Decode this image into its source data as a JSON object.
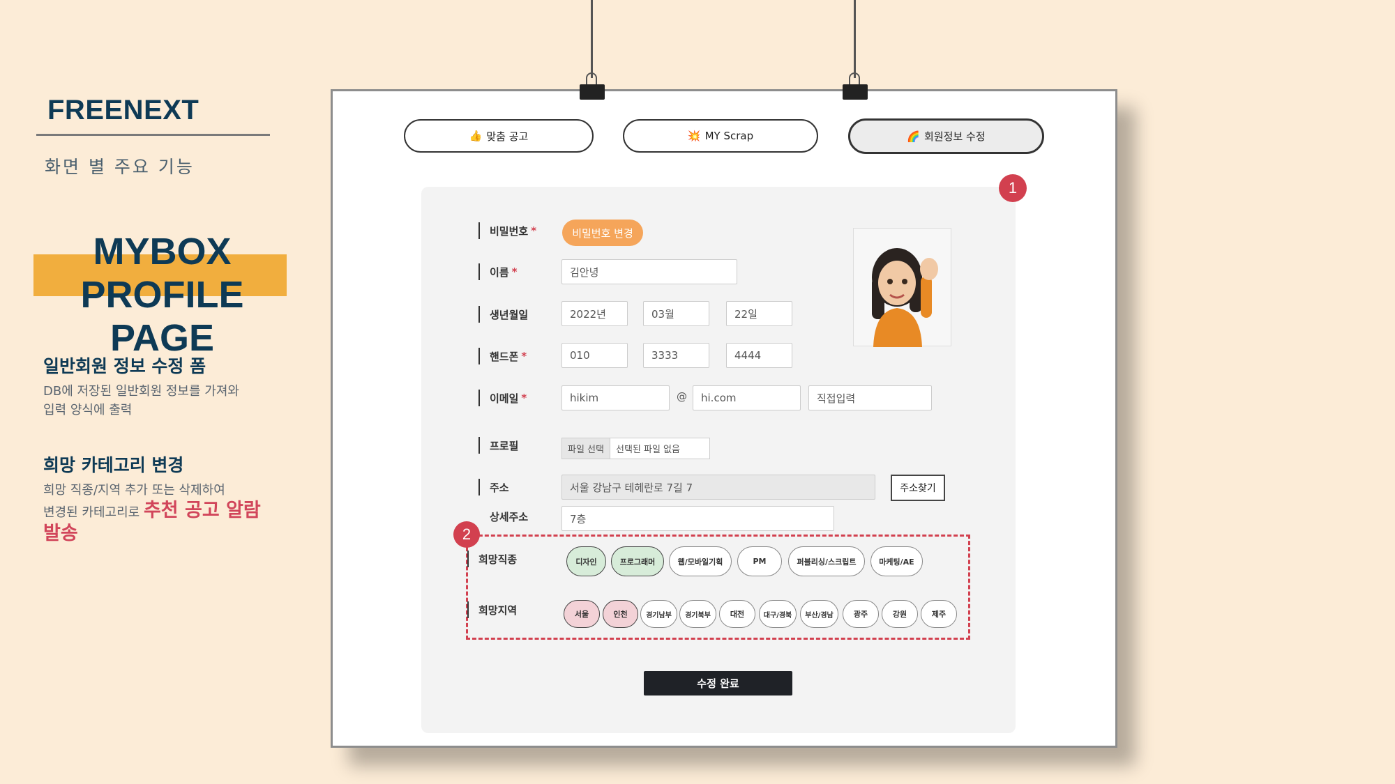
{
  "left": {
    "brand": "FREENEXT",
    "subtitle": "화면 별 주요 기능",
    "title_line1": "MYBOX",
    "title_line2": "PROFILE PAGE",
    "section1": {
      "heading": "일반회원 정보 수정 폼",
      "line1": "DB에 저장된 일반회원 정보를 가져와",
      "line2": "입력 양식에 출력"
    },
    "section2": {
      "heading": "희망 카테고리 변경",
      "line1": "희망 직종/지역 추가 또는 삭제하여",
      "line2_plain": "변경된 카테고리로 ",
      "line2_accent": "추천 공고 알람",
      "line3_accent": "발송"
    }
  },
  "tabs": [
    {
      "icon": "👍",
      "label": "맞춤 공고",
      "active": false
    },
    {
      "icon": "💥",
      "label": "MY Scrap",
      "active": false
    },
    {
      "icon": "🌈",
      "label": "회원정보 수정",
      "active": true
    }
  ],
  "badges": {
    "one": "1",
    "two": "2"
  },
  "form": {
    "password": {
      "label": "비밀번호",
      "required": "*",
      "button": "비밀번호 변경"
    },
    "name": {
      "label": "이름",
      "required": "*",
      "value": "김안녕"
    },
    "birth": {
      "label": "생년월일",
      "year": "2022년",
      "month": "03월",
      "day": "22일"
    },
    "phone": {
      "label": "핸드폰",
      "required": "*",
      "p1": "010",
      "p2": "3333",
      "p3": "4444"
    },
    "email": {
      "label": "이메일",
      "required": "*",
      "local": "hikim",
      "at": "@",
      "domain": "hi.com",
      "direct": "직접입력"
    },
    "profile": {
      "label": "프로필",
      "file_button": "파일 선택",
      "file_status": "선택된 파일 없음"
    },
    "address": {
      "label": "주소",
      "value": "서울 강남구 테헤란로 7길 7",
      "search_button": "주소찾기"
    },
    "detail_address": {
      "label": "상세주소",
      "value": "7층"
    },
    "jobs": {
      "label": "희망직종",
      "items": [
        {
          "label": "디자인",
          "selected": true
        },
        {
          "label": "프로그래머",
          "selected": true
        },
        {
          "label": "웹/모바일기획",
          "selected": false
        },
        {
          "label": "PM",
          "selected": false
        },
        {
          "label": "퍼블리싱/스크립트",
          "selected": false
        },
        {
          "label": "마케팅/AE",
          "selected": false
        }
      ]
    },
    "regions": {
      "label": "희망지역",
      "items": [
        {
          "label": "서울",
          "selected": true
        },
        {
          "label": "인천",
          "selected": true
        },
        {
          "label": "경기남부",
          "selected": false
        },
        {
          "label": "경기북부",
          "selected": false
        },
        {
          "label": "대전",
          "selected": false
        },
        {
          "label": "대구/경북",
          "selected": false
        },
        {
          "label": "부산/경남",
          "selected": false
        },
        {
          "label": "광주",
          "selected": false
        },
        {
          "label": "강원",
          "selected": false
        },
        {
          "label": "제주",
          "selected": false
        }
      ]
    },
    "submit": "수정 완료"
  },
  "colors": {
    "accent_red": "#d2404f",
    "highlight_orange": "#f1ae3e",
    "navy": "#0e3a55",
    "job_selected": "#d7ecd9",
    "region_selected": "#f3d2d7"
  }
}
